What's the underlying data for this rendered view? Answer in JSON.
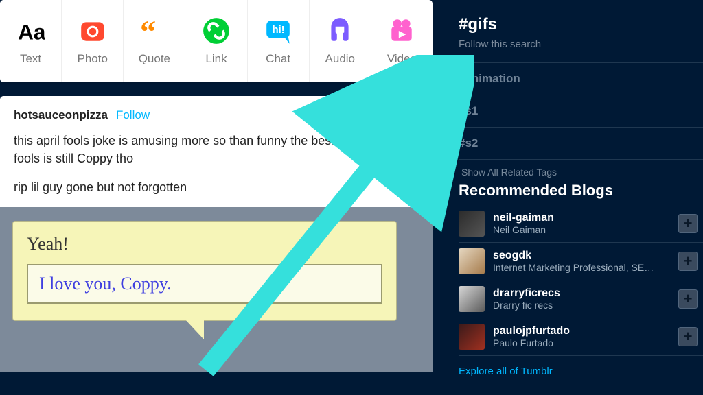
{
  "compose": {
    "items": [
      {
        "label": "Text",
        "icon": "text-icon"
      },
      {
        "label": "Photo",
        "icon": "photo-icon"
      },
      {
        "label": "Quote",
        "icon": "quote-icon"
      },
      {
        "label": "Link",
        "icon": "link-icon"
      },
      {
        "label": "Chat",
        "icon": "chat-icon"
      },
      {
        "label": "Audio",
        "icon": "audio-icon"
      },
      {
        "label": "Video",
        "icon": "video-icon"
      }
    ]
  },
  "colors": {
    "text_icon": "#000000",
    "photo_icon": "#ff492f",
    "quote_icon": "#ff8a00",
    "link_icon": "#00cf35",
    "chat_icon": "#00b8ff",
    "audio_icon": "#7c5cff",
    "video_icon": "#ff62ce"
  },
  "post": {
    "author": "hotsauceonpizza",
    "follow_label": "Follow",
    "body_p1": "this april fools joke is amusing more so than funny the best tumblr april fools is still Coppy tho",
    "body_p2": "rip lil guy gone but not forgotten",
    "bubble_title": "Yeah!",
    "bubble_text": "I love you, Coppy."
  },
  "sidebar": {
    "search_tag": "#gifs",
    "follow_search": "Follow this search",
    "related_tags": [
      "#animation",
      "#s1",
      "#s2"
    ],
    "show_all": "Show All Related Tags",
    "rec_title": "Recommended Blogs",
    "blogs": [
      {
        "name": "neil-gaiman",
        "subtitle": "Neil Gaiman"
      },
      {
        "name": "seogdk",
        "subtitle": "Internet Marketing Professional, SEO C"
      },
      {
        "name": "drarryficrecs",
        "subtitle": "Drarry fic recs"
      },
      {
        "name": "paulojpfurtado",
        "subtitle": "Paulo Furtado"
      }
    ],
    "explore": "Explore all of Tumblr"
  }
}
